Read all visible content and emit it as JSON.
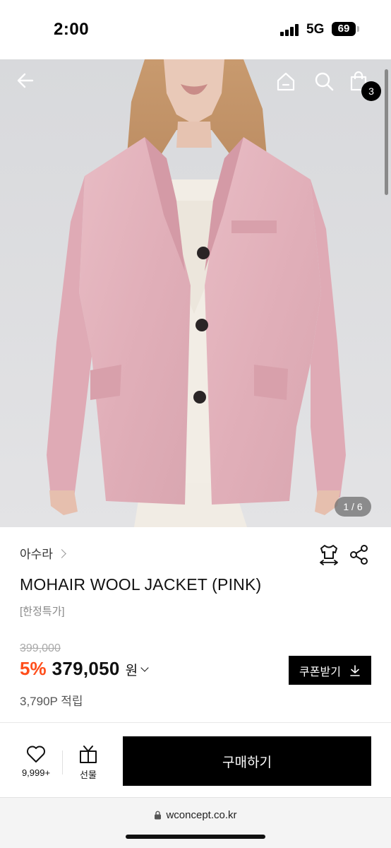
{
  "status_bar": {
    "time": "2:00",
    "network": "5G",
    "battery": "69"
  },
  "hero": {
    "pager": "1 / 6",
    "cart_count": "3",
    "icons": [
      "back-arrow-icon",
      "home-icon",
      "search-icon",
      "shopping-bag-icon"
    ],
    "jacket_color": "#e3b6bf",
    "background_color": "#dcdde0"
  },
  "product": {
    "brand": "아수라",
    "name": "MOHAIR WOOL JACKET (PINK)",
    "tag": "[한정특가]",
    "original_price": "399,000",
    "discount": "5%",
    "price": "379,050",
    "currency": "원",
    "points": "3,790P 적립",
    "icons": [
      "size-guide-shirt-icon",
      "share-icon"
    ]
  },
  "coupon": {
    "label": "쿠폰받기"
  },
  "actions": {
    "like_count": "9,999+",
    "gift_label": "선물",
    "buy_label": "구매하기"
  },
  "browser": {
    "url": "wconcept.co.kr"
  },
  "colors": {
    "discount": "#ff4e1b",
    "primary_button": "#000000"
  }
}
